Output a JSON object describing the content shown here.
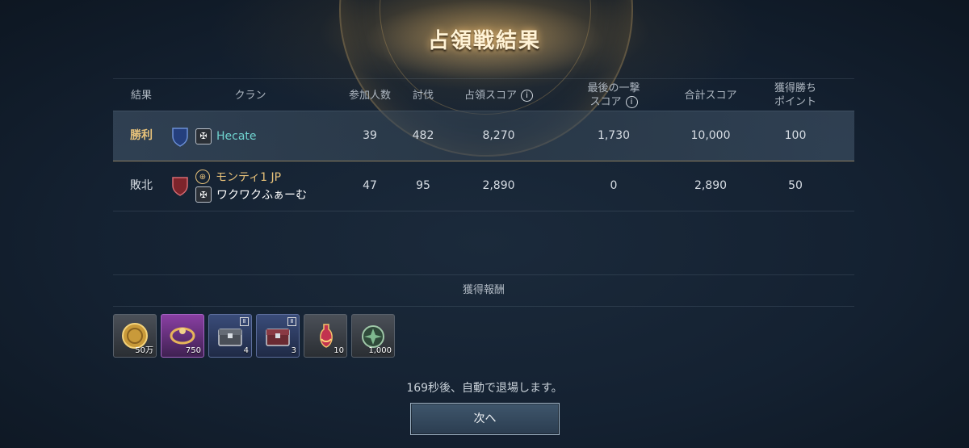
{
  "title": "占領戦結果",
  "headers": {
    "result": "結果",
    "clan": "クラン",
    "participants": "参加人数",
    "kills": "討伐",
    "occupation_score": "占領スコア",
    "last_hit_line1": "最後の一撃",
    "last_hit_line2": "スコア",
    "total_score": "合計スコア",
    "win_points_line1": "獲得勝ち",
    "win_points_line2": "ポイント"
  },
  "rows": [
    {
      "result": "勝利",
      "clan": "Hecate",
      "participants": "39",
      "kills": "482",
      "occupation_score": "8,270",
      "last_hit_score": "1,730",
      "total_score": "10,000",
      "win_points": "100"
    },
    {
      "result": "敗北",
      "alliance": "モンティ1 JP",
      "clan": "ワクワクふぁーむ",
      "participants": "47",
      "kills": "95",
      "occupation_score": "2,890",
      "last_hit_score": "0",
      "total_score": "2,890",
      "win_points": "50"
    }
  ],
  "rewards": {
    "header": "獲得報酬",
    "items": [
      {
        "icon": "gold-coin-icon",
        "count": "50万"
      },
      {
        "icon": "purple-ring-icon",
        "count": "750"
      },
      {
        "icon": "dark-chest-icon",
        "count": "4"
      },
      {
        "icon": "red-chest-icon",
        "count": "3"
      },
      {
        "icon": "potion-icon",
        "count": "10"
      },
      {
        "icon": "green-medal-icon",
        "count": "1,000"
      }
    ]
  },
  "notice": "169秒後、自動で退場します。",
  "next_button": "次へ",
  "colors": {
    "win": "#e8c27a",
    "clan_teal": "#6fd3cf",
    "win_shield": "#2b4f9a",
    "lose_shield": "#9a2b33"
  }
}
